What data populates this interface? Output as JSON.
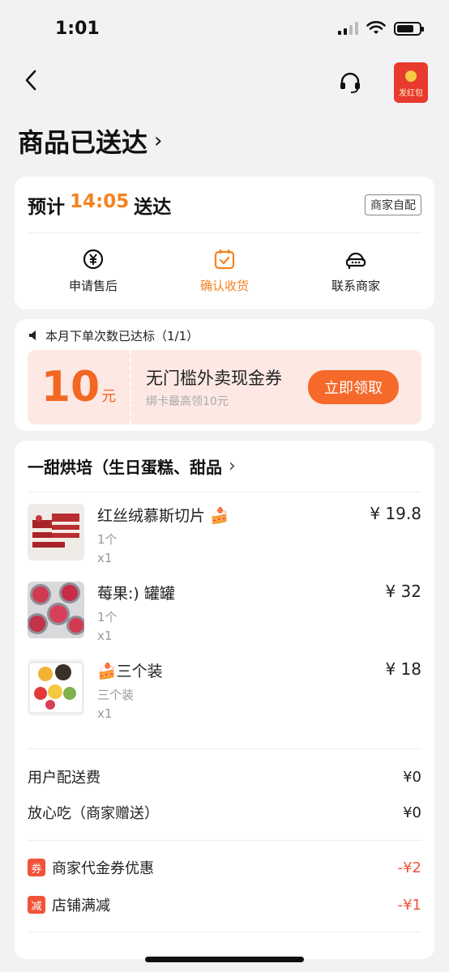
{
  "status": {
    "time": "1:01"
  },
  "hongbao_label": "发红包",
  "page_title": "商品已送达",
  "delivery": {
    "eta_prefix": "预计",
    "eta_time": "14:05",
    "eta_suffix": "送达",
    "tag": "商家自配",
    "actions": [
      {
        "label": "申请售后",
        "icon": "yen-refund-icon"
      },
      {
        "label": "确认收货",
        "icon": "calendar-check-icon"
      },
      {
        "label": "联系商家",
        "icon": "merchant-service-icon"
      }
    ]
  },
  "promo": {
    "header": "本月下单次数已达标（1/1）",
    "amount": "10",
    "unit": "元",
    "title": "无门槛外卖现金券",
    "subtitle": "绑卡最高领10元",
    "button": "立即领取"
  },
  "shop": {
    "name": "一甜烘培（生日蛋糕、甜品"
  },
  "items": [
    {
      "name": "红丝绒慕斯切片 🍰",
      "spec": "1个",
      "qty": "x1",
      "price": "¥ 19.8"
    },
    {
      "name": "莓果:) 罐罐",
      "spec": "1个",
      "qty": "x1",
      "price": "¥ 32"
    },
    {
      "name": "🍰三个装",
      "spec": "三个装",
      "qty": "x1",
      "price": "¥ 18"
    }
  ],
  "fees": [
    {
      "label": "用户配送费",
      "value": "¥0"
    },
    {
      "label": "放心吃（商家赠送）",
      "value": "¥0"
    }
  ],
  "discounts": [
    {
      "badge": "券",
      "label": "商家代金券优惠",
      "value": "-¥2"
    },
    {
      "badge": "减",
      "label": "店铺满减",
      "value": "-¥1"
    }
  ],
  "colors": {
    "accent": "#f58220",
    "discount": "#f0523a",
    "coupon_bg": "#fde8e4"
  }
}
